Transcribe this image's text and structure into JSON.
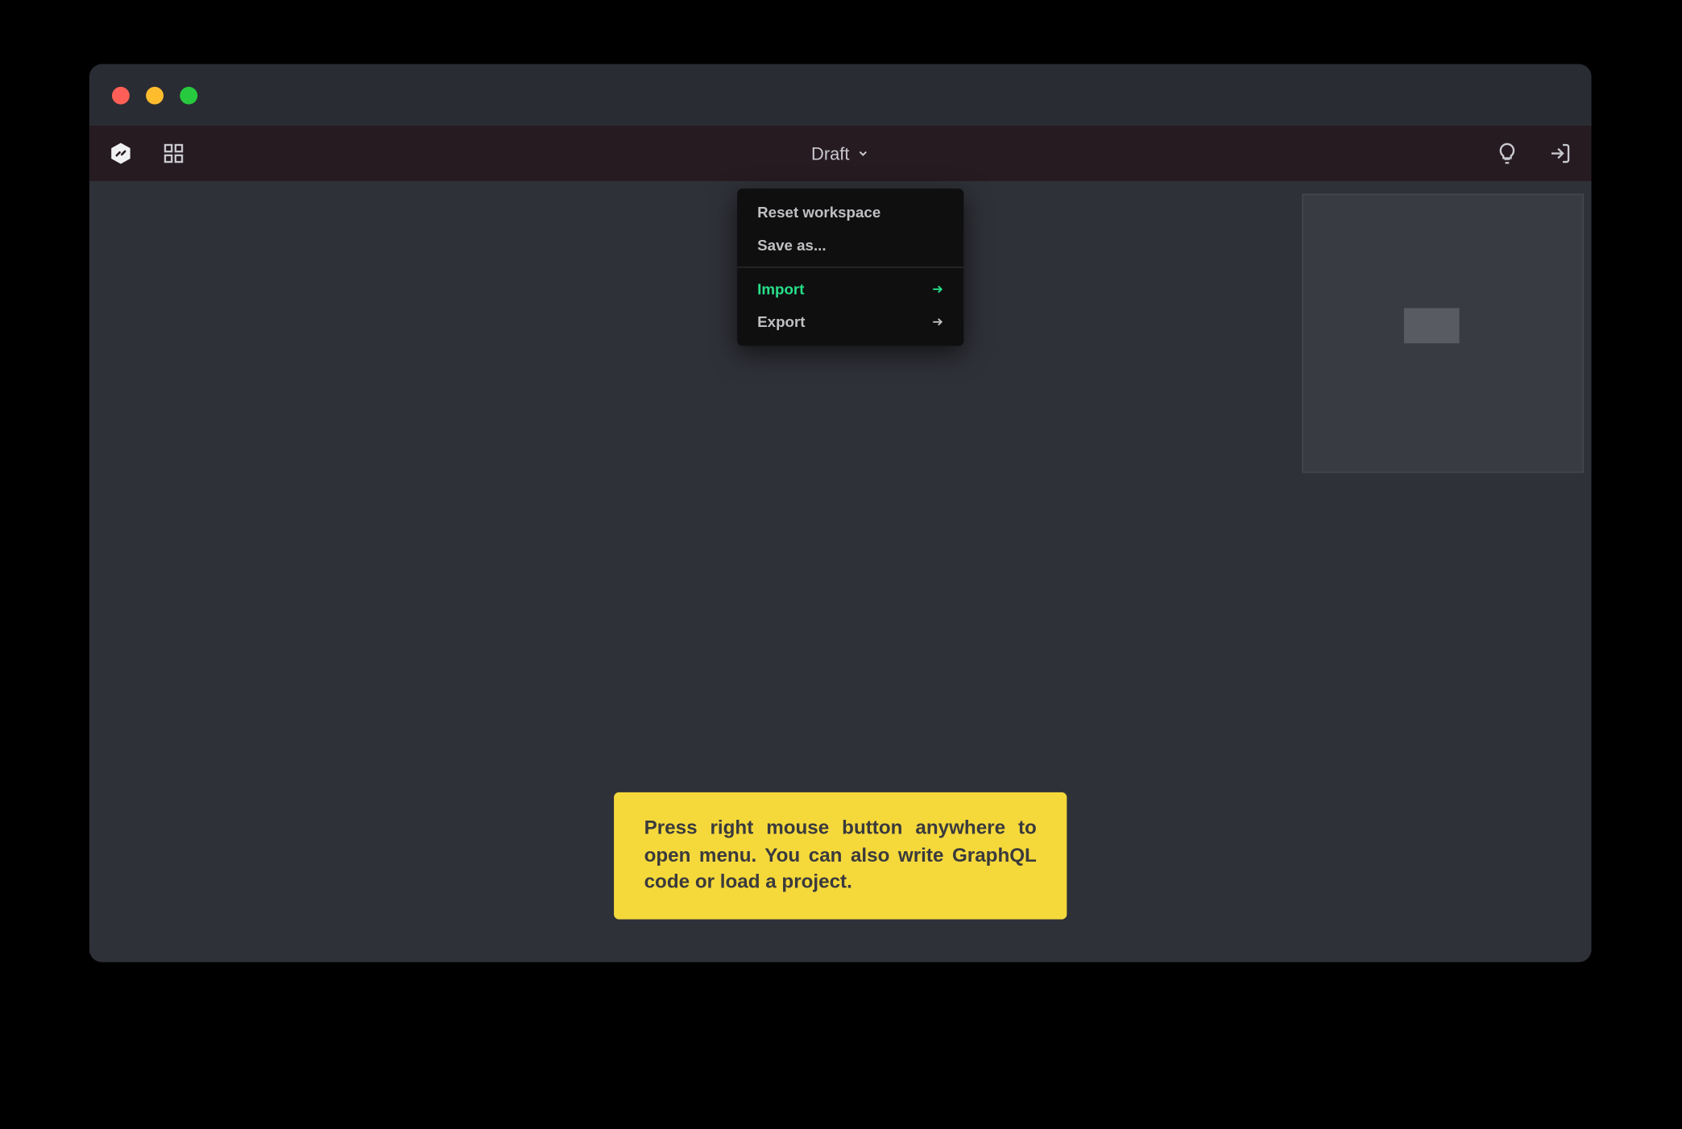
{
  "window": {
    "titlebar": {
      "close": "close",
      "minimize": "minimize",
      "maximize": "maximize"
    }
  },
  "topbar": {
    "draft_label": "Draft"
  },
  "context_menu": {
    "reset_label": "Reset workspace",
    "save_as_label": "Save as...",
    "import_label": "Import",
    "export_label": "Export"
  },
  "hint": {
    "text": "Press right mouse button anywhere to open menu. You can also write GraphQL code or load a project."
  },
  "colors": {
    "highlight": "#27e08a",
    "hint_bg": "#f5d93b"
  }
}
